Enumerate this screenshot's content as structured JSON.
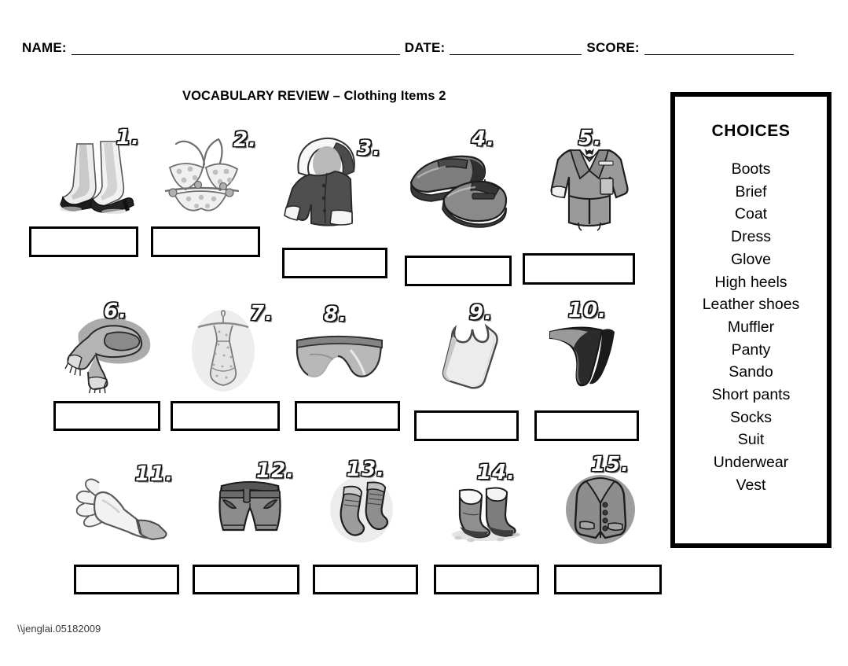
{
  "header": {
    "name_label": "NAME:",
    "date_label": "DATE:",
    "score_label": "SCORE:",
    "name_value": "",
    "date_value": "",
    "score_value": ""
  },
  "title": "VOCABULARY REVIEW – Clothing Items 2",
  "choices": {
    "heading": "CHOICES",
    "items": [
      "Boots",
      "Brief",
      "Coat",
      "Dress",
      "Glove",
      "High heels",
      "Leather shoes",
      "Muffler",
      "Panty",
      "Sando",
      "Short pants",
      "Socks",
      "Suit",
      "Underwear",
      "Vest"
    ]
  },
  "items": [
    {
      "number": "1.",
      "icon": "high-heels-icon",
      "answer": "",
      "placeholder": ""
    },
    {
      "number": "2.",
      "icon": "bikini-icon",
      "answer": "",
      "placeholder": ""
    },
    {
      "number": "3.",
      "icon": "hooded-coat-icon",
      "answer": "",
      "placeholder": ""
    },
    {
      "number": "4.",
      "icon": "leather-shoes-icon",
      "answer": "",
      "placeholder": ""
    },
    {
      "number": "5.",
      "icon": "suit-icon",
      "answer": "",
      "placeholder": ""
    },
    {
      "number": "6.",
      "icon": "muffler-icon",
      "answer": "",
      "placeholder": ""
    },
    {
      "number": "7.",
      "icon": "dress-icon",
      "answer": "",
      "placeholder": ""
    },
    {
      "number": "8.",
      "icon": "brief-icon",
      "answer": "",
      "placeholder": ""
    },
    {
      "number": "9.",
      "icon": "sando-icon",
      "answer": "",
      "placeholder": ""
    },
    {
      "number": "10.",
      "icon": "panty-icon",
      "answer": "",
      "placeholder": ""
    },
    {
      "number": "11.",
      "icon": "glove-icon",
      "answer": "",
      "placeholder": ""
    },
    {
      "number": "12.",
      "icon": "short-pants-icon",
      "answer": "",
      "placeholder": ""
    },
    {
      "number": "13.",
      "icon": "socks-icon",
      "answer": "",
      "placeholder": ""
    },
    {
      "number": "14.",
      "icon": "boots-icon",
      "answer": "",
      "placeholder": ""
    },
    {
      "number": "15.",
      "icon": "vest-icon",
      "answer": "",
      "placeholder": ""
    }
  ],
  "footer": {
    "watermark": "\\\\jenglai.05182009"
  },
  "colors": {
    "ink": "#000000",
    "paper": "#ffffff",
    "art_dark": "#4a4a4a",
    "art_mid": "#8e8e8e",
    "art_light": "#d0d0d0"
  }
}
